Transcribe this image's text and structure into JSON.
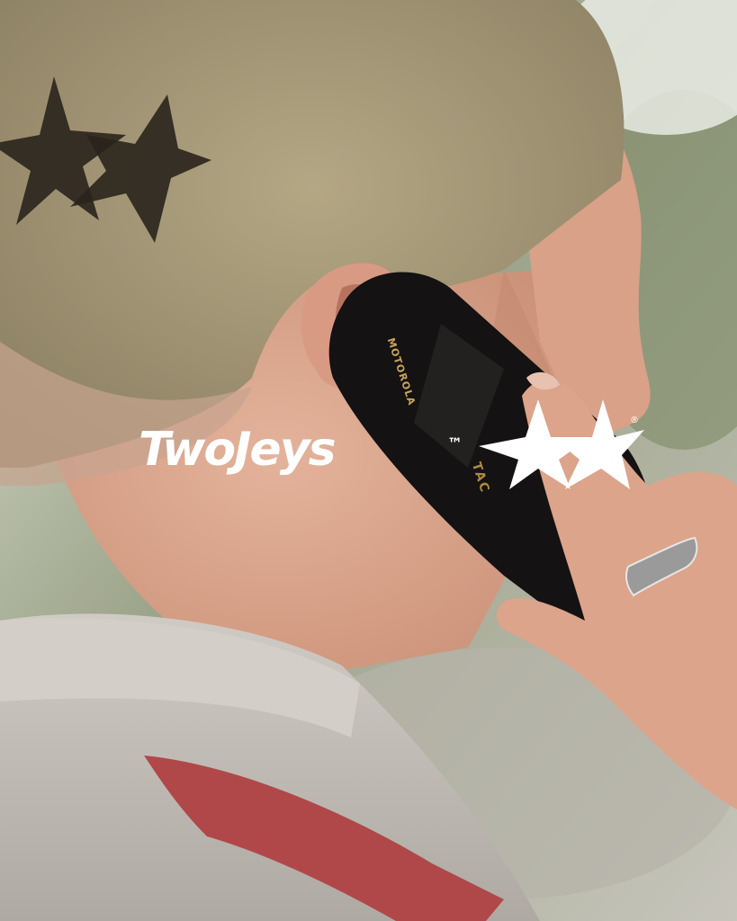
{
  "logo": {
    "word": "TwoJeys",
    "trademark": "™",
    "mark": "two-stars-icon",
    "registered": "®",
    "color": "#ffffff"
  },
  "phone": {
    "brand": "MOTOROLA",
    "model": "TAC",
    "accent": "#c9a55a"
  },
  "scene": {
    "shirt_color": "#c4c0b9",
    "stripe_color": "#b0484a",
    "skin_color": "#d9a58c",
    "hair_color": "#a69a7a",
    "background_color": "#8e9481"
  }
}
